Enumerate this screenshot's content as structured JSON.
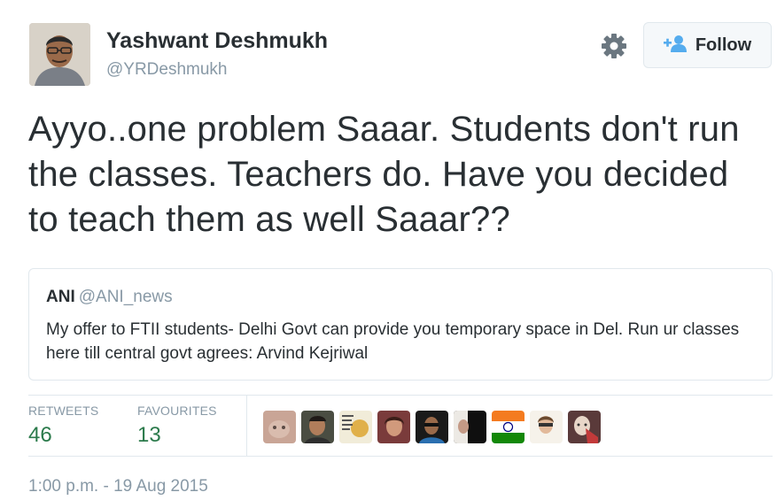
{
  "author": {
    "name": "Yashwant Deshmukh",
    "handle": "@YRDeshmukh"
  },
  "actions": {
    "follow_label": "Follow",
    "settings_icon": "gear-icon",
    "follow_icon": "add-user-icon"
  },
  "tweet": {
    "text": "Ayyo..one problem Saaar. Students don't run the classes. Teachers do. Have you decided to teach them as well Saaar??"
  },
  "quoted": {
    "name": "ANI",
    "handle": "@ANI_news",
    "text": "My offer to FTII students- Delhi Govt can provide you temporary space in Del. Run ur classes here till central govt agrees: Arvind Kejriwal"
  },
  "stats": {
    "retweets_label": "RETWEETS",
    "retweets_value": "46",
    "favourites_label": "FAVOURITES",
    "favourites_value": "13"
  },
  "timestamp": "1:00 p.m. - 19 Aug 2015",
  "colors": {
    "text": "#292f33",
    "muted": "#8899a6",
    "stat_green": "#2b7a4b",
    "follow_blue": "#55acee",
    "border": "#e1e8ed"
  }
}
